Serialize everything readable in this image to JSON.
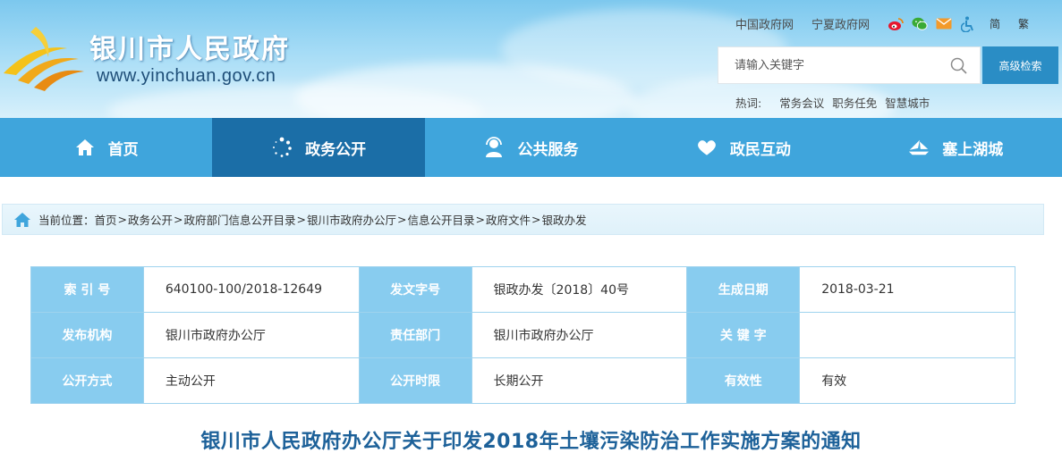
{
  "header": {
    "site_title": "银川市人民政府",
    "site_url": "www.yinchuan.gov.cn",
    "top_links": [
      "中国政府网",
      "宁夏政府网"
    ],
    "lang_simplified": "简",
    "lang_traditional": "繁",
    "icons": [
      "weibo-icon",
      "wechat-icon",
      "mail-icon",
      "accessibility-icon"
    ]
  },
  "search": {
    "placeholder": "请输入关键字",
    "advanced_label": "高级检索"
  },
  "hot": {
    "label": "热词:",
    "words": [
      "常务会议",
      "职务任免",
      "智慧城市"
    ]
  },
  "nav": {
    "items": [
      {
        "label": "首页",
        "icon": "home-icon"
      },
      {
        "label": "政务公开",
        "icon": "dots-icon"
      },
      {
        "label": "公共服务",
        "icon": "service-icon"
      },
      {
        "label": "政民互动",
        "icon": "hands-heart-icon"
      },
      {
        "label": "塞上湖城",
        "icon": "sail-icon"
      }
    ],
    "active_index": 1
  },
  "breadcrumb": {
    "prefix": "当前位置：",
    "items": [
      "首页",
      "政务公开",
      "政府部门信息公开目录",
      "银川市政府办公厅",
      "信息公开目录",
      "政府文件",
      "银政办发"
    ],
    "separator": ">"
  },
  "meta": {
    "rows": [
      [
        {
          "k": "索 引 号",
          "v": "640100-100/2018-12649"
        },
        {
          "k": "发文字号",
          "v": "银政办发〔2018〕40号"
        },
        {
          "k": "生成日期",
          "v": "2018-03-21"
        }
      ],
      [
        {
          "k": "发布机构",
          "v": "银川市政府办公厅"
        },
        {
          "k": "责任部门",
          "v": "银川市政府办公厅"
        },
        {
          "k": "关 键 字",
          "v": ""
        }
      ],
      [
        {
          "k": "公开方式",
          "v": "主动公开"
        },
        {
          "k": "公开时限",
          "v": "长期公开"
        },
        {
          "k": "有效性",
          "v": "有效"
        }
      ]
    ]
  },
  "document": {
    "title": "银川市人民政府办公厅关于印发2018年土壤污染防治工作实施方案的通知"
  },
  "colors": {
    "nav_bg": "#3fa5dc",
    "nav_active": "#1b6ea7",
    "table_key_bg": "#88ccef",
    "title_color": "#1d6199",
    "button_bg": "#2a8dc5"
  }
}
